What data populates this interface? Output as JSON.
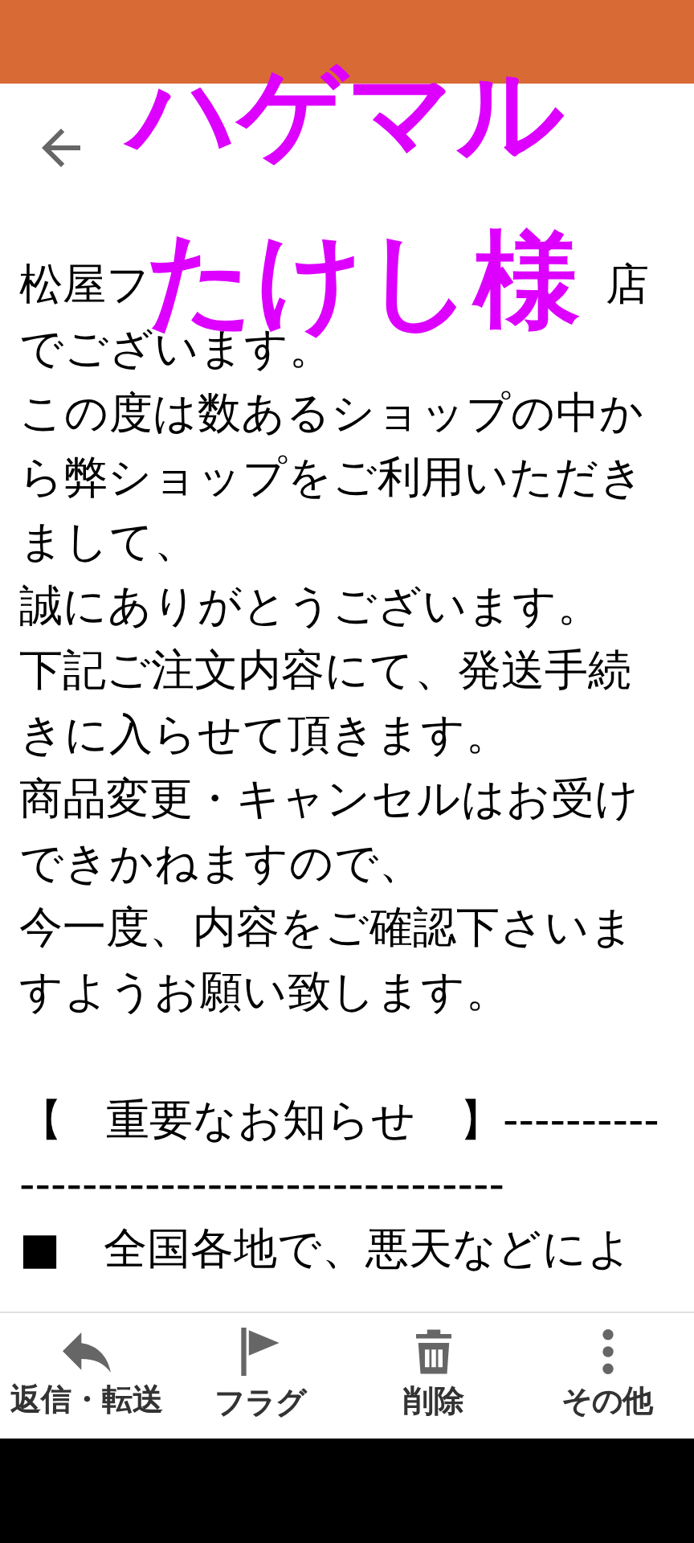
{
  "overlay_text": [
    "ハゲマル",
    "たけし様"
  ],
  "first_line_fragments": [
    "松屋フ",
    "店"
  ],
  "body_paragraphs": [
    "でございます。",
    "この度は数あるショップの中から弊ショップをご利用いただきまして、",
    "誠にありがとうございます。",
    "下記ご注文内容にて、発送手続きに入らせて頂きます。",
    "商品変更・キャンセルはお受けできかねますので、",
    "今一度、内容をご確認下さいますようお願い致します。",
    "【　重要なお知らせ　】-----------------------------------------",
    "■　全国各地で、悪天などによ"
  ],
  "toolbar": [
    {
      "kind": "reply",
      "label": "返信・転送"
    },
    {
      "kind": "flag",
      "label": "フラグ"
    },
    {
      "kind": "delete",
      "label": "削除"
    },
    {
      "kind": "more",
      "label": "その他"
    }
  ]
}
